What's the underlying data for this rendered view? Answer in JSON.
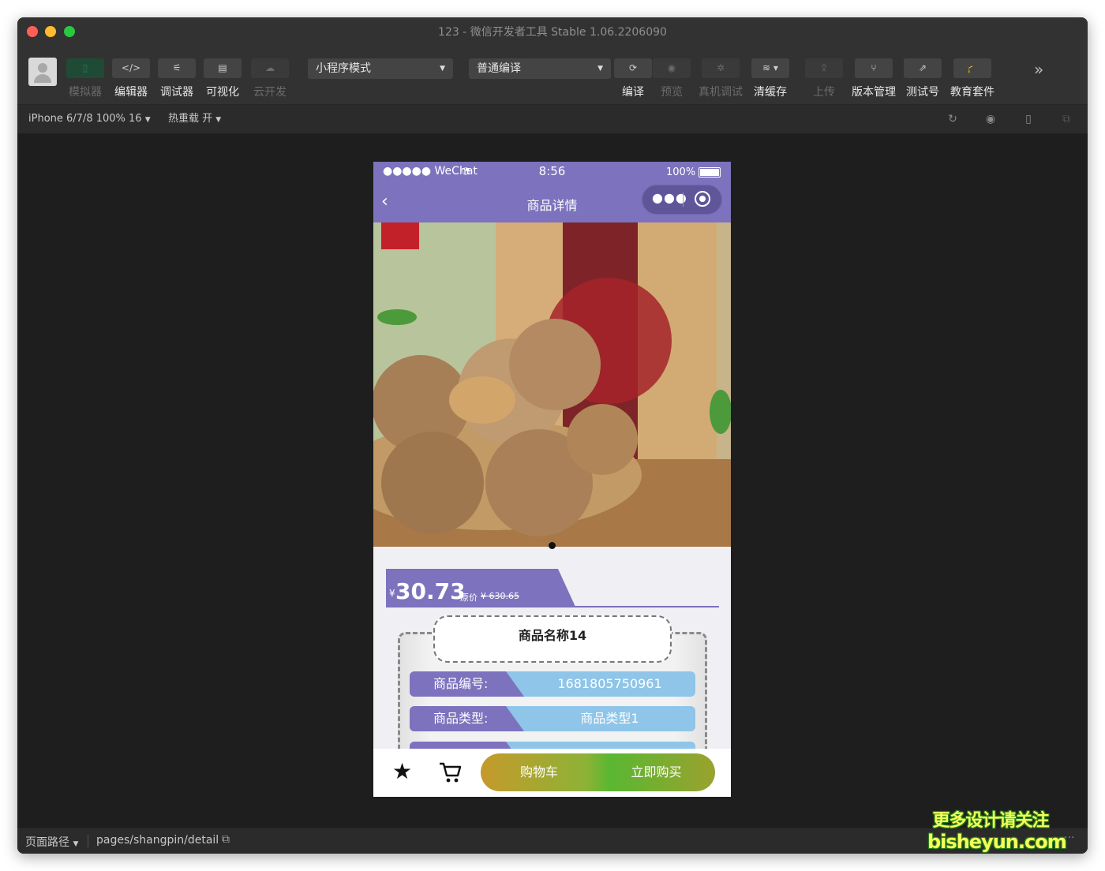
{
  "window": {
    "title": "123 - 微信开发者工具 Stable 1.06.2206090"
  },
  "toolbar": {
    "simulator": "模拟器",
    "editor": "编辑器",
    "debugger": "调试器",
    "visual": "可视化",
    "cloud": "云开发",
    "mode_select": "小程序模式",
    "compile_select": "普通编译",
    "compile": "编译",
    "preview": "预览",
    "remote_debug": "真机调试",
    "clear_cache": "清缓存",
    "upload": "上传",
    "version": "版本管理",
    "test_account": "测试号",
    "education": "教育套件"
  },
  "secondbar": {
    "device": "iPhone 6/7/8 100% 16",
    "hot_reload": "热重载 开"
  },
  "phone": {
    "status": {
      "signal": "●●●●● WeChat",
      "time": "8:56",
      "battery": "100%"
    },
    "nav_title": "商品详情",
    "price": "30.73",
    "currency": "¥",
    "original_label": "原价",
    "original_price": "¥ 630.65",
    "product_name": "商品名称14",
    "rows": [
      {
        "label": "商品编号:",
        "value": "1681805750961"
      },
      {
        "label": "商品类型:",
        "value": "商品类型1"
      }
    ],
    "cart_button": "购物车",
    "buy_button": "立即购买"
  },
  "footer": {
    "path_label": "页面路径",
    "path": "pages/shangpin/detail"
  },
  "watermark": {
    "line1": "更多设计请关注",
    "line2": "bisheyun.com"
  }
}
